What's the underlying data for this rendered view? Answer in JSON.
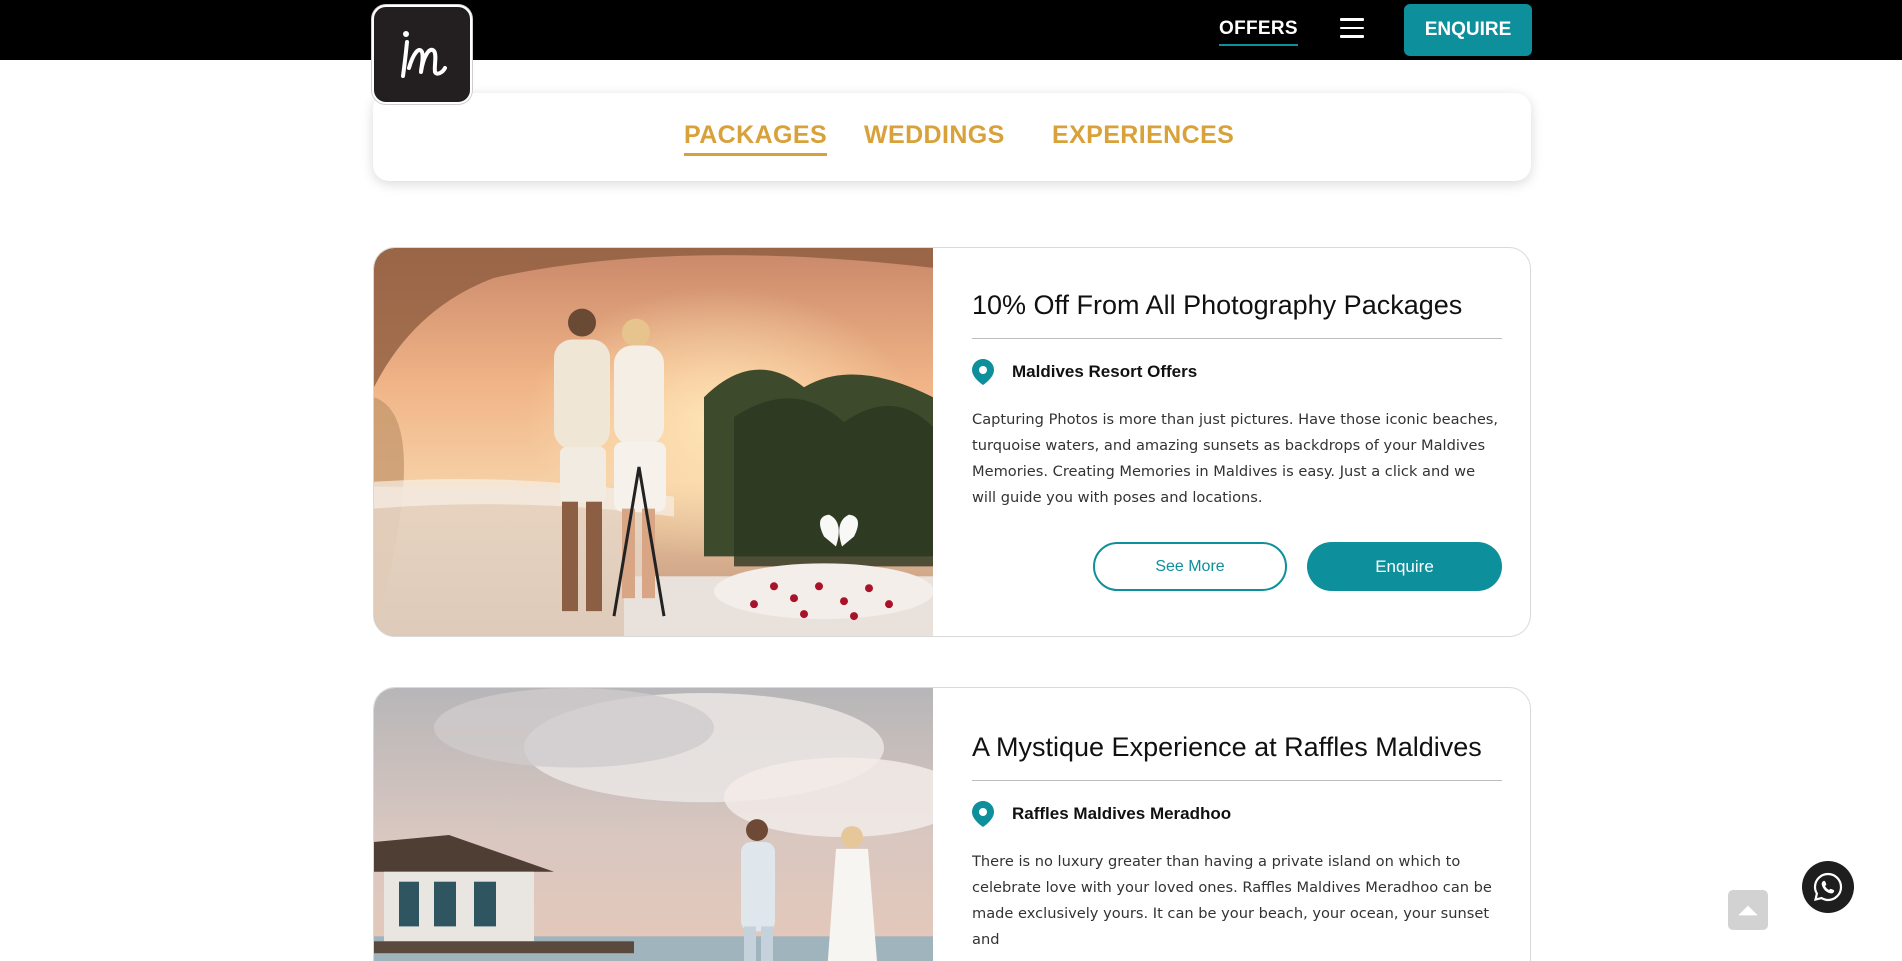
{
  "header": {
    "logo_text": "im",
    "nav_offers": "OFFERS",
    "enquire_label": "ENQUIRE"
  },
  "tabs": [
    {
      "label": "PACKAGES",
      "active": true
    },
    {
      "label": "WEDDINGS",
      "active": false
    },
    {
      "label": "EXPERIENCES",
      "active": false
    }
  ],
  "offers": [
    {
      "title": "10% Off From All Photography Packages",
      "location": "Maldives Resort Offers",
      "description": "Capturing Photos is more than just pictures. Have those iconic beaches, turquoise waters, and amazing sunsets as backdrops of your Maldives Memories. Creating Memories in Maldives is easy. Just a click and we will guide you with poses and locations.",
      "see_more_label": "See More",
      "enquire_label": "Enquire"
    },
    {
      "title": "A Mystique Experience at Raffles Maldives",
      "location": "Raffles Maldives Meradhoo",
      "description": "There is no luxury greater than having a private island on which to celebrate love with your loved ones. Raffles Maldives Meradhoo can be made exclusively yours. It can be your beach, your ocean, your sunset and"
    }
  ],
  "colors": {
    "accent_teal": "#0e8f9c",
    "tab_gold": "#d8a13a",
    "topbar": "#000000"
  },
  "icons": {
    "location": "map-pin-icon",
    "menu": "hamburger-menu-icon",
    "whatsapp": "whatsapp-icon",
    "scroll_top": "chevron-up-icon"
  }
}
